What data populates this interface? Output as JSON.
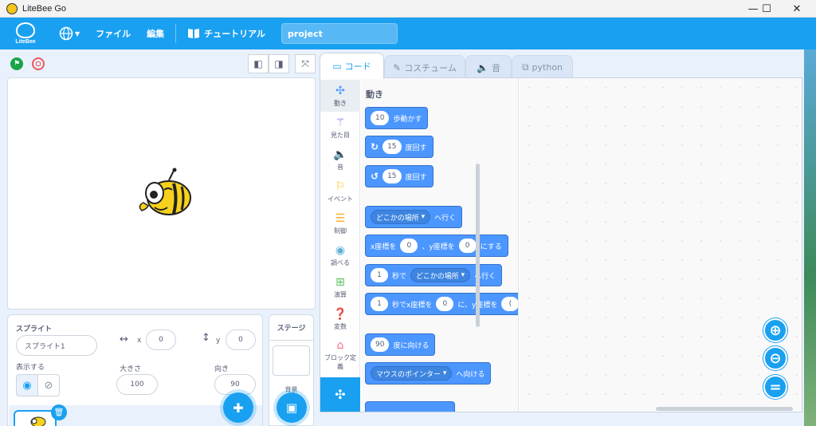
{
  "window": {
    "title": "LiteBee Go",
    "controls": [
      "—",
      "☐",
      "✕"
    ]
  },
  "menubar": {
    "logo_text": "LiteBee",
    "menus": [
      "ファイル",
      "編集"
    ],
    "tutorial_label": "チュートリアル",
    "project_name": "project"
  },
  "tabs": [
    {
      "label": "コード",
      "icon": "code-icon",
      "active": true
    },
    {
      "label": "コスチューム",
      "icon": "brush-icon",
      "active": false
    },
    {
      "label": "音",
      "icon": "speaker-icon",
      "active": false
    },
    {
      "label": "python",
      "icon": "python-icon",
      "active": false
    }
  ],
  "categories": [
    {
      "label": "動き",
      "icon": "drone-icon",
      "color": "#4c97ff"
    },
    {
      "label": "見た目",
      "icon": "wand-icon",
      "color": "#9966ff"
    },
    {
      "label": "音",
      "icon": "speaker-icon",
      "color": "#cf63cf"
    },
    {
      "label": "イベント",
      "icon": "flag-icon",
      "color": "#ffbf00"
    },
    {
      "label": "制御",
      "icon": "sliders-icon",
      "color": "#ffab19"
    },
    {
      "label": "調べる",
      "icon": "signal-icon",
      "color": "#5cb1d6"
    },
    {
      "label": "演算",
      "icon": "calculator-icon",
      "color": "#59c059"
    },
    {
      "label": "変数",
      "icon": "question-icon",
      "color": "#ff8c1a"
    },
    {
      "label": "ブロック定義",
      "icon": "temple-icon",
      "color": "#ff6680"
    }
  ],
  "flyout": {
    "title": "動き",
    "blocks": {
      "move_steps": {
        "value": "10",
        "text": "歩動かす"
      },
      "turn_right": {
        "value": "15",
        "text": "度回す"
      },
      "turn_left": {
        "value": "15",
        "text": "度回す"
      },
      "goto": {
        "dropdown": "どこかの場所",
        "text": "へ行く"
      },
      "goto_xy": {
        "prefix": "x座標を",
        "x": "0",
        "mid": "、y座標を",
        "y": "0",
        "suffix": "にする"
      },
      "glide_to": {
        "value": "1",
        "mid": "秒で",
        "dropdown": "どこかの場所",
        "suffix": "へ行く"
      },
      "glide_xy": {
        "value": "1",
        "mid": "秒でx座標を",
        "x": "0",
        "mid2": "に、y座標を",
        "y": "("
      },
      "point_direction": {
        "value": "90",
        "text": "度に向ける"
      },
      "point_towards": {
        "dropdown": "マウスのポインター",
        "text": "へ向ける"
      }
    }
  },
  "sprite_info": {
    "title": "スプライト",
    "name": "スプライト1",
    "x_label": "x",
    "x_value": "0",
    "y_label": "y",
    "y_value": "0",
    "show_label": "表示する",
    "size_label": "大きさ",
    "size_value": "100",
    "direction_label": "向き",
    "direction_value": "90"
  },
  "stage_panel": {
    "title": "ステージ",
    "backdrop_label": "背景"
  },
  "colors": {
    "accent": "#1aa0f0",
    "motion_block": "#4c97ff",
    "green_flag": "#1aa34a",
    "stop": "#ec5959"
  }
}
